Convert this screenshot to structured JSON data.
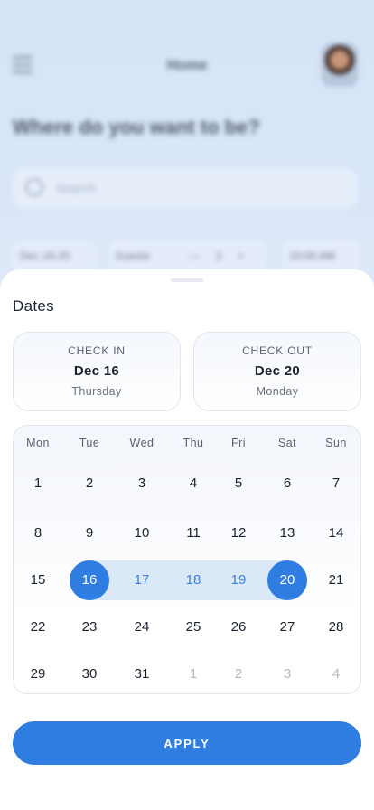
{
  "background": {
    "title": "Home",
    "heading": "Where do you want to be?",
    "search_placeholder": "Search",
    "chips": [
      "Dec 16-20",
      "Guests",
      "—",
      "2",
      "+",
      "10:00 AM"
    ]
  },
  "sheet": {
    "title": "Dates",
    "check_in": {
      "label": "CHECK IN",
      "date": "Dec 16",
      "day": "Thursday"
    },
    "check_out": {
      "label": "CHECK OUT",
      "date": "Dec 20",
      "day": "Monday"
    },
    "weekdays": [
      "Mon",
      "Tue",
      "Wed",
      "Thu",
      "Fri",
      "Sat",
      "Sun"
    ],
    "weeks": [
      [
        {
          "d": "1"
        },
        {
          "d": "2"
        },
        {
          "d": "3"
        },
        {
          "d": "4"
        },
        {
          "d": "5"
        },
        {
          "d": "6"
        },
        {
          "d": "7"
        }
      ],
      [
        {
          "d": "8"
        },
        {
          "d": "9"
        },
        {
          "d": "10"
        },
        {
          "d": "11"
        },
        {
          "d": "12"
        },
        {
          "d": "13"
        },
        {
          "d": "14"
        }
      ],
      [
        {
          "d": "15"
        },
        {
          "d": "16",
          "s": "selected"
        },
        {
          "d": "17",
          "s": "range"
        },
        {
          "d": "18",
          "s": "range"
        },
        {
          "d": "19",
          "s": "range"
        },
        {
          "d": "20",
          "s": "selected"
        },
        {
          "d": "21"
        }
      ],
      [
        {
          "d": "22"
        },
        {
          "d": "23"
        },
        {
          "d": "24"
        },
        {
          "d": "25"
        },
        {
          "d": "26"
        },
        {
          "d": "27"
        },
        {
          "d": "28"
        }
      ],
      [
        {
          "d": "29"
        },
        {
          "d": "30"
        },
        {
          "d": "31"
        },
        {
          "d": "1",
          "s": "muted"
        },
        {
          "d": "2",
          "s": "muted"
        },
        {
          "d": "3",
          "s": "muted"
        },
        {
          "d": "4",
          "s": "muted"
        }
      ]
    ],
    "apply_label": "APPLY"
  },
  "colors": {
    "accent": "#2f7de1",
    "range": "#dbe8f8",
    "range_text": "#3a82d8",
    "muted_text": "#b3b8c2"
  },
  "icons": {
    "menu": "menu-icon",
    "search": "search-icon"
  }
}
